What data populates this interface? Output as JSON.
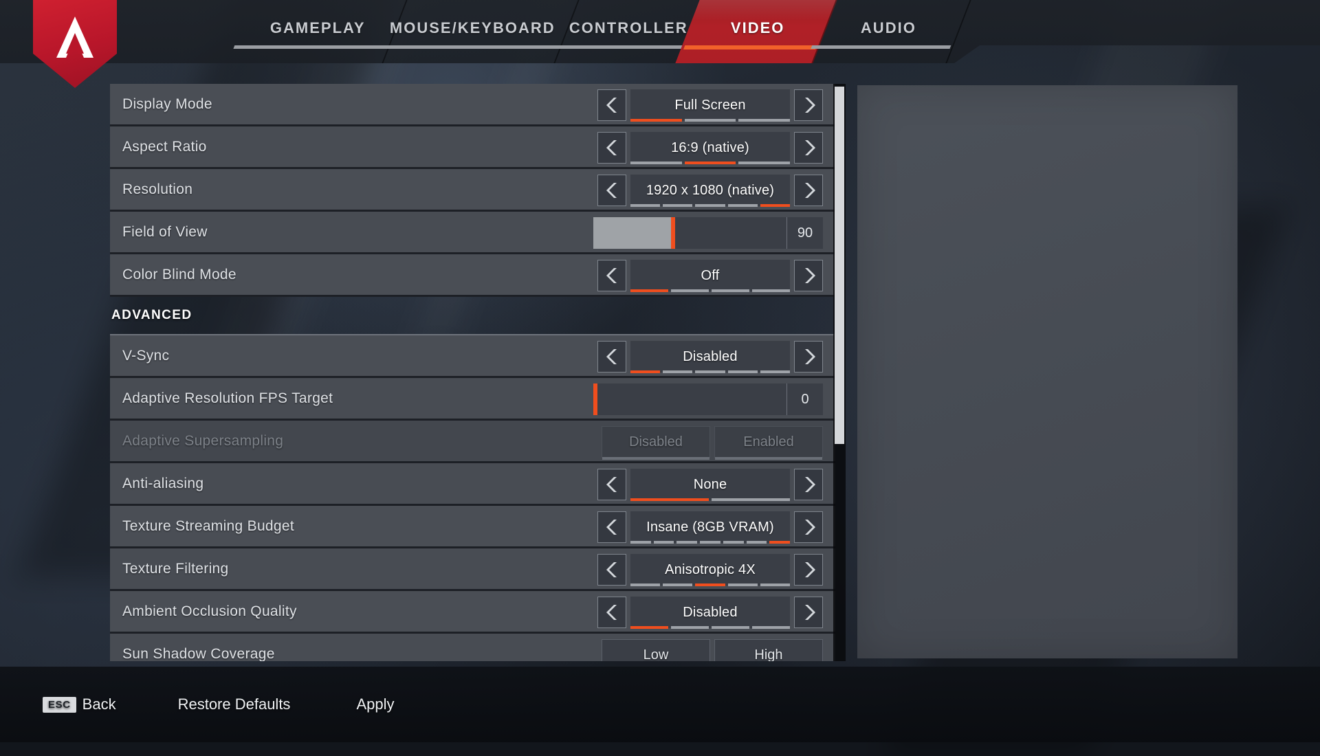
{
  "app": {
    "title": "Apex Legends Settings",
    "logo_icon": "apex-logo-icon"
  },
  "nav": {
    "tabs": [
      {
        "label": "GAMEPLAY",
        "selected": false
      },
      {
        "label": "MOUSE/KEYBOARD",
        "selected": false
      },
      {
        "label": "CONTROLLER",
        "selected": false
      },
      {
        "label": "VIDEO",
        "selected": true
      },
      {
        "label": "AUDIO",
        "selected": false
      }
    ],
    "selected_tab": "VIDEO",
    "accent_color": "#f04e1e",
    "selected_tab_color": "#b02027"
  },
  "settings": {
    "rows": [
      {
        "name": "Display Mode",
        "type": "stepper",
        "value": "Full Screen",
        "segments": 3,
        "selected_index": 0,
        "left_arrow": "chevron-left-icon",
        "right_arrow": "chevron-right-icon",
        "disabled": false
      },
      {
        "name": "Aspect Ratio",
        "type": "stepper",
        "value": "16:9 (native)",
        "segments": 3,
        "selected_index": 1,
        "left_arrow": "chevron-left-icon",
        "right_arrow": "chevron-right-icon",
        "disabled": false
      },
      {
        "name": "Resolution",
        "type": "stepper",
        "value": "1920 x 1080 (native)",
        "segments": 5,
        "selected_index": 4,
        "left_arrow": "chevron-left-icon",
        "right_arrow": "chevron-right-icon",
        "disabled": false
      },
      {
        "name": "Field of View",
        "type": "slider",
        "value": "90",
        "fill_percent": 41,
        "disabled": false
      },
      {
        "name": "Color Blind Mode",
        "type": "stepper",
        "value": "Off",
        "segments": 4,
        "selected_index": 0,
        "left_arrow": "chevron-left-icon",
        "right_arrow": "chevron-right-icon",
        "disabled": false
      }
    ],
    "section_label": "ADVANCED",
    "advanced_rows": [
      {
        "name": "V-Sync",
        "type": "stepper",
        "value": "Disabled",
        "segments": 5,
        "selected_index": 0,
        "left_arrow": "chevron-left-icon",
        "right_arrow": "chevron-right-icon",
        "disabled": false
      },
      {
        "name": "Adaptive Resolution FPS Target",
        "type": "slider",
        "value": "0",
        "fill_percent": 0,
        "disabled": false
      },
      {
        "name": "Adaptive Supersampling",
        "type": "toggle",
        "option_a": "Disabled",
        "option_b": "Enabled",
        "selected_option": "",
        "disabled": true
      },
      {
        "name": "Anti-aliasing",
        "type": "stepper",
        "value": "None",
        "segments": 2,
        "selected_index": 0,
        "left_arrow": "chevron-left-icon",
        "right_arrow": "chevron-right-icon",
        "disabled": false
      },
      {
        "name": "Texture Streaming Budget",
        "type": "stepper",
        "value": "Insane (8GB VRAM)",
        "segments": 7,
        "selected_index": 6,
        "left_arrow": "chevron-left-icon",
        "right_arrow": "chevron-right-icon",
        "disabled": false
      },
      {
        "name": "Texture Filtering",
        "type": "stepper",
        "value": "Anisotropic 4X",
        "segments": 5,
        "selected_index": 2,
        "left_arrow": "chevron-left-icon",
        "right_arrow": "chevron-right-icon",
        "disabled": false
      },
      {
        "name": "Ambient Occlusion Quality",
        "type": "stepper",
        "value": "Disabled",
        "segments": 4,
        "selected_index": 0,
        "left_arrow": "chevron-left-icon",
        "right_arrow": "chevron-right-icon",
        "disabled": false
      },
      {
        "name": "Sun Shadow Coverage",
        "type": "toggle",
        "option_a": "Low",
        "option_b": "High",
        "selected_option": "",
        "disabled": false
      }
    ]
  },
  "scrollbar": {
    "name": "settings-scrollbar",
    "thumb_position": "top"
  },
  "footer": {
    "back": {
      "key": "ESC",
      "label": "Back"
    },
    "restore_defaults": "Restore Defaults",
    "apply": "Apply"
  }
}
